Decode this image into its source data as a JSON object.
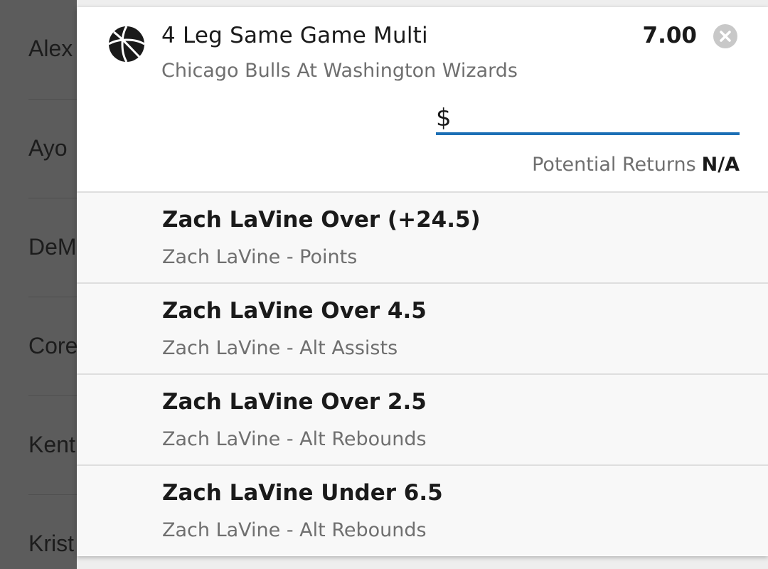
{
  "background_list": [
    "Alex",
    "Ayo",
    "DeM",
    "Core",
    "Kent",
    "Krist"
  ],
  "bet": {
    "title": "4 Leg Same Game Multi",
    "odds": "7.00",
    "event": "Chicago Bulls At Washington Wizards",
    "stake_prefix": "$",
    "stake_value": "",
    "potential_returns_label": "Potential Returns",
    "potential_returns_value": "N/A",
    "sport_icon": "basketball-icon",
    "close_icon": "close-icon"
  },
  "legs": [
    {
      "selection": "Zach LaVine Over (+24.5)",
      "market": "Zach LaVine - Points"
    },
    {
      "selection": "Zach LaVine Over 4.5",
      "market": "Zach LaVine - Alt Assists"
    },
    {
      "selection": "Zach LaVine Over 2.5",
      "market": "Zach LaVine - Alt Rebounds"
    },
    {
      "selection": "Zach LaVine Under 6.5",
      "market": "Zach LaVine - Alt Rebounds"
    }
  ],
  "colors": {
    "accent": "#1b6fb5",
    "overlay": "#5c5c5c",
    "muted_text": "#6f6f6f"
  }
}
